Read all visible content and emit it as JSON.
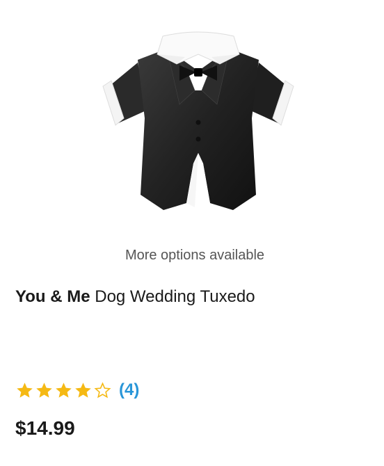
{
  "product": {
    "image_alt": "dog-tuxedo-product-image",
    "options_note": "More options available",
    "brand": "You & Me",
    "name": "Dog Wedding Tuxedo",
    "rating": {
      "value": 4,
      "max": 5,
      "review_count": "(4)"
    },
    "price": "$14.99"
  },
  "colors": {
    "star": "#f5b914",
    "review_link": "#2996d8"
  }
}
